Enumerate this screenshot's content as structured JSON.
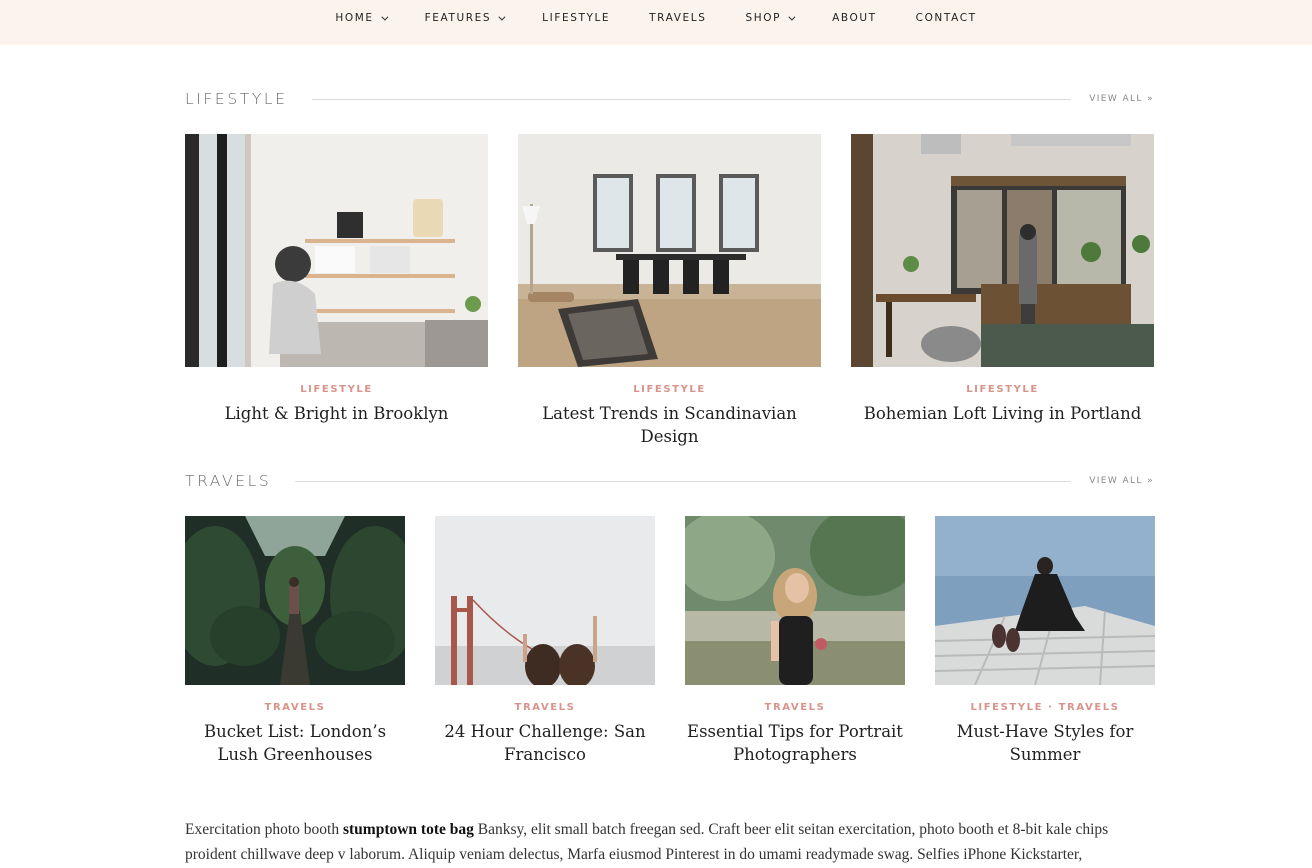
{
  "nav": {
    "items": [
      {
        "label": "HOME",
        "dropdown": true
      },
      {
        "label": "FEATURES",
        "dropdown": true
      },
      {
        "label": "LIFESTYLE",
        "dropdown": false
      },
      {
        "label": "TRAVELS",
        "dropdown": false
      },
      {
        "label": "SHOP",
        "dropdown": true
      },
      {
        "label": "ABOUT",
        "dropdown": false
      },
      {
        "label": "CONTACT",
        "dropdown": false
      }
    ]
  },
  "lifestyle": {
    "title": "LIFESTYLE",
    "view_all": "VIEW ALL »",
    "posts": [
      {
        "category": "LIFESTYLE",
        "title": "Light & Bright in Brooklyn",
        "image": "bright-room-photo"
      },
      {
        "category": "LIFESTYLE",
        "title": "Latest Trends in Scandinavian Design",
        "image": "scandinavian-dining-photo"
      },
      {
        "category": "LIFESTYLE",
        "title": "Bohemian Loft Living in Portland",
        "image": "bohemian-loft-photo"
      }
    ]
  },
  "travels": {
    "title": "TRAVELS",
    "view_all": "VIEW ALL »",
    "posts": [
      {
        "category": "TRAVELS",
        "title": "Bucket List: London’s Lush Greenhouses",
        "image": "greenhouse-photo"
      },
      {
        "category": "TRAVELS",
        "title": "24 Hour Challenge: San Francisco",
        "image": "golden-gate-photo"
      },
      {
        "category": "TRAVELS",
        "title": "Essential Tips for Portrait Photographers",
        "image": "portrait-photo"
      },
      {
        "category": "LIFESTYLE · TRAVELS",
        "categories": [
          "LIFESTYLE",
          "TRAVELS"
        ],
        "title": "Must-Have Styles for Summer",
        "image": "dock-photo"
      }
    ]
  },
  "body": {
    "line1_pre": "Exercitation photo booth ",
    "line1_bold": "stumptown tote bag",
    "line1_post": " Banksy, elit small batch freegan sed. Craft beer elit seitan exercitation, photo booth et 8-bit kale chips",
    "line2": "proident chillwave deep v laborum. Aliquip veniam delectus, Marfa eiusmod Pinterest in do umami readymade swag. Selfies iPhone Kickstarter,"
  },
  "colors": {
    "nav_bg": "#fcf3ec",
    "category": "#d9938a",
    "section_title": "#6b6b6b"
  }
}
